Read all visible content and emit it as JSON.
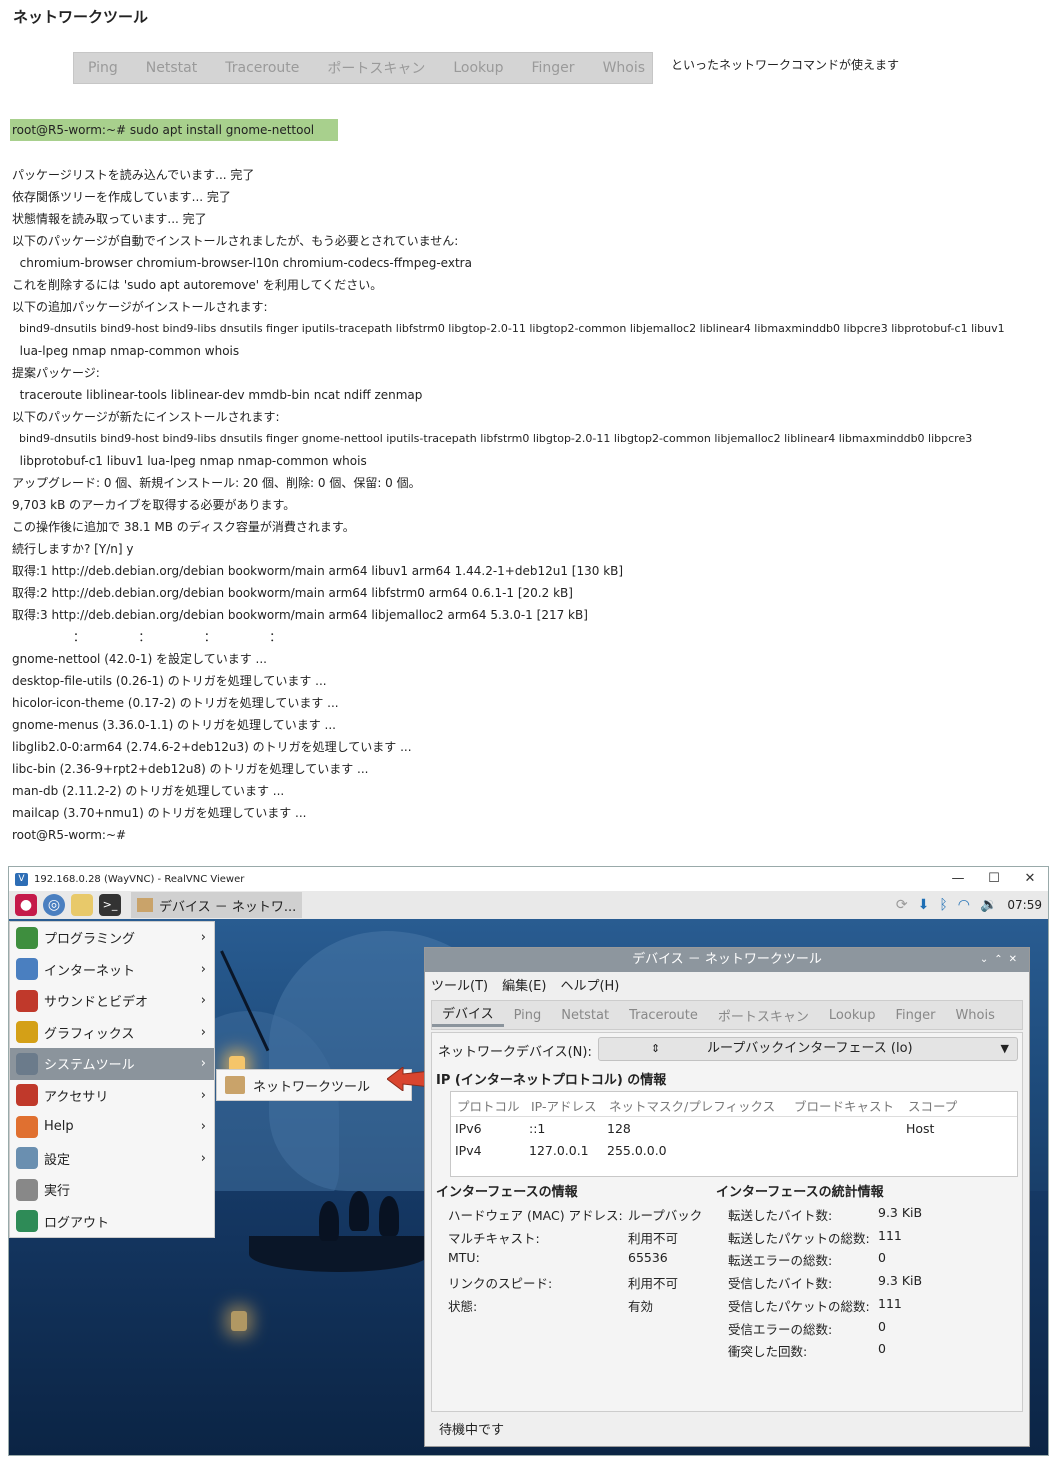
{
  "doc": {
    "title": "ネットワークツール",
    "tabs": [
      "Ping",
      "Netstat",
      "Traceroute",
      "ポートスキャン",
      "Lookup",
      "Finger",
      "Whois"
    ],
    "tabs_note": "といったネットワークコマンドが使えます",
    "command": "root@R5-worm:~# sudo apt install gnome-nettool",
    "log": [
      "パッケージリストを読み込んでいます... 完了",
      "依存関係ツリーを作成しています... 完了",
      "状態情報を読み取っています... 完了",
      "以下のパッケージが自動でインストールされましたが、もう必要とされていません:",
      "  chromium-browser chromium-browser-l10n chromium-codecs-ffmpeg-extra",
      "これを削除するには 'sudo apt autoremove' を利用してください。",
      "以下の追加パッケージがインストールされます:",
      "  bind9-dnsutils bind9-host bind9-libs dnsutils finger iputils-tracepath libfstrm0 libgtop-2.0-11 libgtop2-common libjemalloc2 liblinear4 libmaxminddb0 libpcre3 libprotobuf-c1 libuv1",
      "  lua-lpeg nmap nmap-common whois",
      "提案パッケージ:",
      "  traceroute liblinear-tools liblinear-dev mmdb-bin ncat ndiff zenmap",
      "以下のパッケージが新たにインストールされます:",
      "  bind9-dnsutils bind9-host bind9-libs dnsutils finger gnome-nettool iputils-tracepath libfstrm0 libgtop-2.0-11 libgtop2-common libjemalloc2 liblinear4 libmaxminddb0 libpcre3",
      "  libprotobuf-c1 libuv1 lua-lpeg nmap nmap-common whois",
      "アップグレード: 0 個、新規インストール: 20 個、削除: 0 個、保留: 0 個。",
      "9,703 kB のアーカイブを取得する必要があります。",
      "この操作後に追加で 38.1 MB のディスク容量が消費されます。",
      "続行しますか? [Y/n] y",
      "取得:1 http://deb.debian.org/debian bookworm/main arm64 libuv1 arm64 1.44.2-1+deb12u1 [130 kB]",
      "取得:2 http://deb.debian.org/debian bookworm/main arm64 libfstrm0 arm64 0.6.1-1 [20.2 kB]",
      "取得:3 http://deb.debian.org/debian bookworm/main arm64 libjemalloc2 arm64 5.3.0-1 [217 kB]",
      "                ：              ：              ：              ：",
      "gnome-nettool (42.0-1) を設定しています ...",
      "desktop-file-utils (0.26-1) のトリガを処理しています ...",
      "hicolor-icon-theme (0.17-2) のトリガを処理しています ...",
      "gnome-menus (3.36.0-1.1) のトリガを処理しています ...",
      "libglib2.0-0:arm64 (2.74.6-2+deb12u3) のトリガを処理しています ...",
      "libc-bin (2.36-9+rpt2+deb12u8) のトリガを処理しています ...",
      "man-db (2.11.2-2) のトリガを処理しています ...",
      "mailcap (3.70+nmu1) のトリガを処理しています ...",
      "root@R5-worm:~#"
    ]
  },
  "vnc": {
    "window_title": "192.168.0.28 (WayVNC) - RealVNC Viewer",
    "taskbar_app": "デバイス － ネットワ...",
    "clock": "07:59",
    "menu": [
      {
        "label": "プログラミング",
        "icon": "programming-icon",
        "color": "#3e8e3e"
      },
      {
        "label": "インターネット",
        "icon": "globe-icon",
        "color": "#4a7fc0"
      },
      {
        "label": "サウンドとビデオ",
        "icon": "media-icon",
        "color": "#c0392b"
      },
      {
        "label": "グラフィックス",
        "icon": "paint-icon",
        "color": "#d4a017"
      },
      {
        "label": "システムツール",
        "icon": "gear-icon",
        "color": "#6b7b8b"
      },
      {
        "label": "アクセサリ",
        "icon": "knife-icon",
        "color": "#c0392b"
      },
      {
        "label": "Help",
        "icon": "lifebuoy-icon",
        "color": "#e07030"
      },
      {
        "label": "設定",
        "icon": "settings-icon",
        "color": "#6a8fb0"
      },
      {
        "label": "実行",
        "icon": "run-icon",
        "color": "#888888"
      },
      {
        "label": "ログアウト",
        "icon": "logout-icon",
        "color": "#2e8b57"
      }
    ],
    "submenu_item": "ネットワークツール"
  },
  "nettool": {
    "title": "デバイス － ネットワークツール",
    "menubar": [
      "ツール(T)",
      "編集(E)",
      "ヘルプ(H)"
    ],
    "tabs": [
      "デバイス",
      "Ping",
      "Netstat",
      "Traceroute",
      "ポートスキャン",
      "Lookup",
      "Finger",
      "Whois"
    ],
    "device_label": "ネットワークデバイス(N):",
    "device_value": "ループバックインターフェース (lo)",
    "ip_section": "IP (インターネットプロトコル) の情報",
    "ip_headers": [
      "プロトコル",
      "IP-アドレス",
      "ネットマスク/プレフィックス",
      "ブロードキャスト",
      "スコープ"
    ],
    "ip_rows": [
      [
        "IPv6",
        "::1",
        "128",
        "",
        "Host"
      ],
      [
        "IPv4",
        "127.0.0.1",
        "255.0.0.0",
        "",
        ""
      ]
    ],
    "iface_section": "インターフェースの情報",
    "iface": [
      [
        "ハードウェア (MAC) アドレス:",
        "ループバック"
      ],
      [
        "マルチキャスト:",
        "利用不可"
      ],
      [
        "MTU:",
        "65536"
      ],
      [
        "リンクのスピード:",
        "利用不可"
      ],
      [
        "状態:",
        "有効"
      ]
    ],
    "stats_section": "インターフェースの統計情報",
    "stats": [
      [
        "転送したバイト数:",
        "9.3 KiB"
      ],
      [
        "転送したパケットの総数:",
        "111"
      ],
      [
        "転送エラーの総数:",
        "0"
      ],
      [
        "受信したバイト数:",
        "9.3 KiB"
      ],
      [
        "受信したパケットの総数:",
        "111"
      ],
      [
        "受信エラーの総数:",
        "0"
      ],
      [
        "衝突した回数:",
        "0"
      ]
    ],
    "status": "待機中です"
  }
}
